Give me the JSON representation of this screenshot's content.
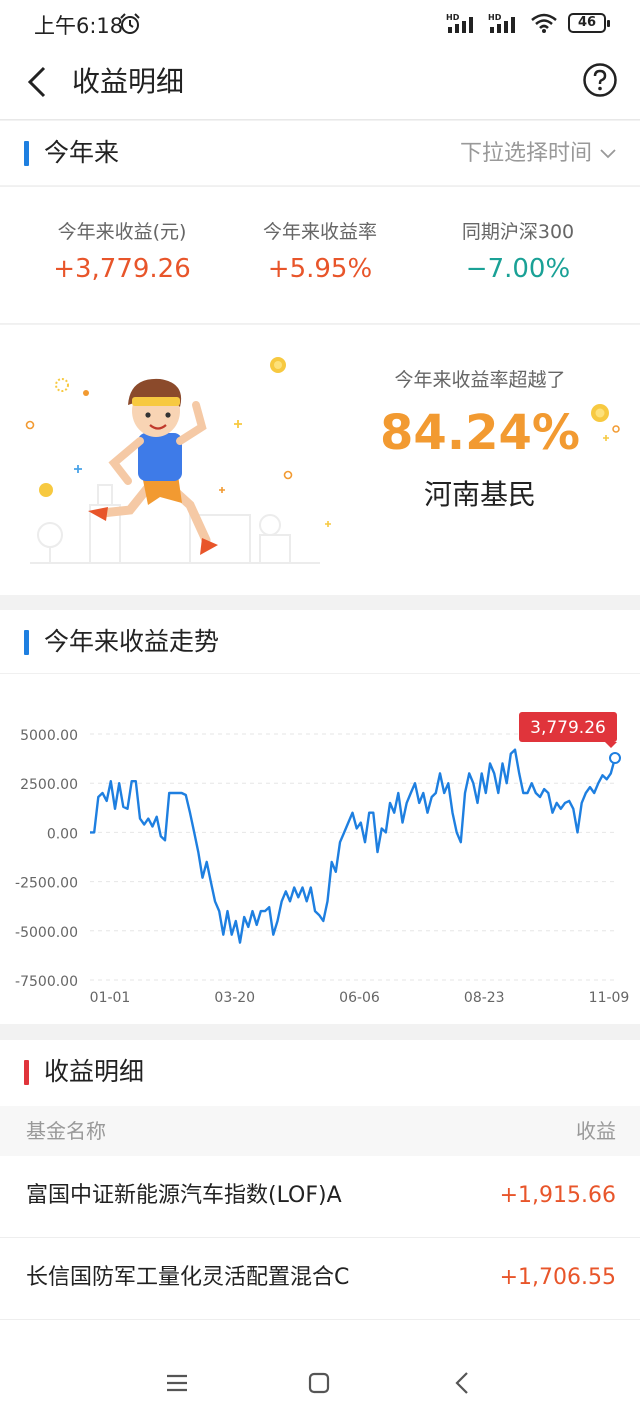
{
  "status_bar": {
    "time": "上午6:18",
    "network_1": "HD",
    "network_2": "HD",
    "battery": "46"
  },
  "nav": {
    "title": "收益明细",
    "icons": [
      "back-arrow-icon",
      "help-icon"
    ]
  },
  "period": {
    "title": "今年来",
    "dropdown_label": "下拉选择时间",
    "accent": "#1e7fe0"
  },
  "stats": [
    {
      "label": "今年来收益(元)",
      "value": "+3,779.26",
      "tone": "up"
    },
    {
      "label": "今年来收益率",
      "value": "+5.95%",
      "tone": "up"
    },
    {
      "label": "同期沪深300",
      "value": "−7.00%",
      "tone": "down"
    }
  ],
  "colors": {
    "up": "#e8552a",
    "down": "#1aa196",
    "line": "#1e7fe0",
    "tooltip": "#e0343b",
    "highlight": "#f29a31"
  },
  "promo": {
    "lead": "今年来收益率超越了",
    "percent": "84.24%",
    "region": "河南基民"
  },
  "trend": {
    "title": "今年来收益走势"
  },
  "chart_data": {
    "type": "line",
    "title": "今年来收益走势",
    "xlabel": "",
    "ylabel": "",
    "x_ticks": [
      "01-01",
      "03-20",
      "06-06",
      "08-23",
      "11-09"
    ],
    "y_ticks": [
      "5000.00",
      "2500.00",
      "0.00",
      "-2500.00",
      "-5000.00",
      "-7500.00"
    ],
    "ylim": [
      -7500,
      5000
    ],
    "grid": true,
    "tooltip_value": "3,779.26",
    "series": [
      {
        "values": [
          0,
          0,
          1800,
          2000,
          1600,
          2600,
          1200,
          2500,
          1300,
          1200,
          2600,
          2600,
          700,
          400,
          700,
          300,
          800,
          -200,
          -400,
          2000,
          2000,
          2000,
          2000,
          1900,
          1000,
          0,
          -1000,
          -2300,
          -1500,
          -2500,
          -3500,
          -4000,
          -5200,
          -4000,
          -5200,
          -4500,
          -5600,
          -4300,
          -4800,
          -4000,
          -4700,
          -4000,
          -4000,
          -3800,
          -5200,
          -4500,
          -3500,
          -3000,
          -3500,
          -2800,
          -3300,
          -2800,
          -3500,
          -2800,
          -4000,
          -4200,
          -4500,
          -3500,
          -1500,
          -2000,
          -500,
          0,
          500,
          1000,
          200,
          500,
          -500,
          1000,
          1000,
          -1000,
          200,
          0,
          1500,
          1000,
          2000,
          500,
          1500,
          2000,
          2500,
          1500,
          2000,
          1000,
          1800,
          2000,
          3000,
          2000,
          2500,
          1000,
          0,
          -500,
          2000,
          3000,
          2500,
          1500,
          3000,
          2000,
          3500,
          3000,
          2000,
          3500,
          2500,
          4000,
          4200,
          3000,
          2000,
          2000,
          2500,
          2000,
          1800,
          2200,
          2000,
          1000,
          1500,
          1200,
          1500,
          1600,
          1200,
          0,
          1500,
          2000,
          2300,
          2000,
          2500,
          2900,
          2700,
          3000,
          3779
        ]
      }
    ]
  },
  "details": {
    "title": "收益明细",
    "header_name": "基金名称",
    "header_value": "收益",
    "rows": [
      {
        "name": "富国中证新能源汽车指数(LOF)A",
        "value": "+1,915.66"
      },
      {
        "name": "长信国防军工量化灵活配置混合C",
        "value": "+1,706.55"
      }
    ]
  },
  "system_nav": [
    "menu-icon",
    "home-icon",
    "back-icon"
  ]
}
